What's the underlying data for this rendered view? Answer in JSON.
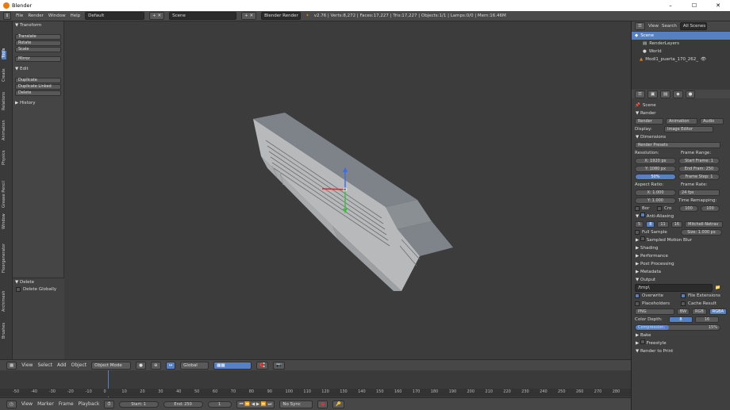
{
  "window": {
    "title": "Blender",
    "minimize": "–",
    "maximize": "☐",
    "close": "✕"
  },
  "info": {
    "menus": [
      "File",
      "Render",
      "Window",
      "Help"
    ],
    "layout": "Default",
    "scene": "Scene",
    "engine": "Blender Render",
    "stats": "v2.76 | Verts:8,272 | Faces:17,227 | Tris:17,227 | Objects:1/1 | Lamps:0/0 | Mem:16.46M"
  },
  "tabs": [
    "Tools",
    "Create",
    "Relations",
    "Animation",
    "Physics",
    "Grease Pencil",
    "Window",
    "Floorgenerator",
    "Archimesh",
    "Brushes"
  ],
  "toolshelf": {
    "transform_title": "Transform",
    "transform_buttons": [
      "Translate",
      "Rotate",
      "Scale",
      "Mirror"
    ],
    "edit_title": "Edit",
    "edit_buttons": [
      "Duplicate",
      "Duplicate Linked",
      "Delete"
    ],
    "history_title": "History",
    "delete_title": "Delete",
    "delete_globally": "Delete Globally"
  },
  "outliner": {
    "tabs": [
      "View",
      "Search",
      "All Scenes"
    ],
    "items": [
      "Scene",
      "RenderLayers",
      "World",
      "Modl1_puerta_170_262_"
    ]
  },
  "props": {
    "scene_label": "Scene",
    "render_title": "Render",
    "render_btns": [
      "Render",
      "Animation",
      "Audio"
    ],
    "display_label": "Display:",
    "display_value": "Image Editor",
    "dimensions_title": "Dimensions",
    "presets": "Render Presets",
    "resolution_label": "Resolution:",
    "res_x": "X:",
    "res_x_val": "1920 px",
    "res_y": "Y:",
    "res_y_val": "1080 px",
    "res_pct": "50%",
    "frame_range_label": "Frame Range:",
    "start_frame": "Start Frame: 1",
    "end_frame": "End Fram: 250",
    "frame_step": "Frame Step: 1",
    "aspect_label": "Aspect Ratio:",
    "asp_x": "X:",
    "asp_x_val": "1.000",
    "asp_y": "Y:",
    "asp_y_val": "1.000",
    "frame_rate_label": "Frame Rate:",
    "fps": "24 fps",
    "time_remap": "Time Remapping:",
    "remap_old": "100",
    "remap_new": "100",
    "border": "Bor",
    "crop": "Cro",
    "aa_title": "Anti-Aliasing",
    "aa_samples": [
      "5",
      "8",
      "11",
      "16"
    ],
    "aa_filter": "Mitchell-Netrav",
    "full_sample": "Full Sample",
    "aa_size": "Size: 1.000 px",
    "collapsed": [
      "Sampled Motion Blur",
      "Shading",
      "Performance",
      "Post Processing",
      "Metadata"
    ],
    "output_title": "Output",
    "output_path": "/tmp\\",
    "overwrite": "Overwrite",
    "file_ext": "File Extensions",
    "placeholders": "Placeholders",
    "cache_result": "Cache Result",
    "format": "PNG",
    "bw": "BW",
    "rgb": "RGB",
    "rgba": "RGBA",
    "color_depth": "Color Depth:",
    "depth_8": "8",
    "depth_16": "16",
    "compression": "Compression:",
    "compression_val": "15%",
    "bake": "Bake",
    "freestyle": "Freestyle",
    "render_to_print": "Render to Print"
  },
  "vp_header": {
    "menus": [
      "View",
      "Select",
      "Add",
      "Object"
    ],
    "mode": "Object Mode",
    "orientation": "Global"
  },
  "timeline": {
    "ticks": [
      "-50",
      "-40",
      "-30",
      "-20",
      "-10",
      "0",
      "10",
      "20",
      "30",
      "40",
      "50",
      "60",
      "70",
      "80",
      "90",
      "100",
      "110",
      "120",
      "130",
      "140",
      "150",
      "160",
      "170",
      "180",
      "190",
      "200",
      "210",
      "220",
      "230",
      "240",
      "250",
      "260",
      "270",
      "280"
    ],
    "menus": [
      "View",
      "Marker",
      "Frame",
      "Playback"
    ],
    "start_label": "Start:",
    "start_val": "1",
    "end_label": "End:",
    "end_val": "250",
    "current": "1",
    "sync": "No Sync"
  },
  "colors": {
    "accent": "#5680c2",
    "select": "#e87d0d"
  }
}
